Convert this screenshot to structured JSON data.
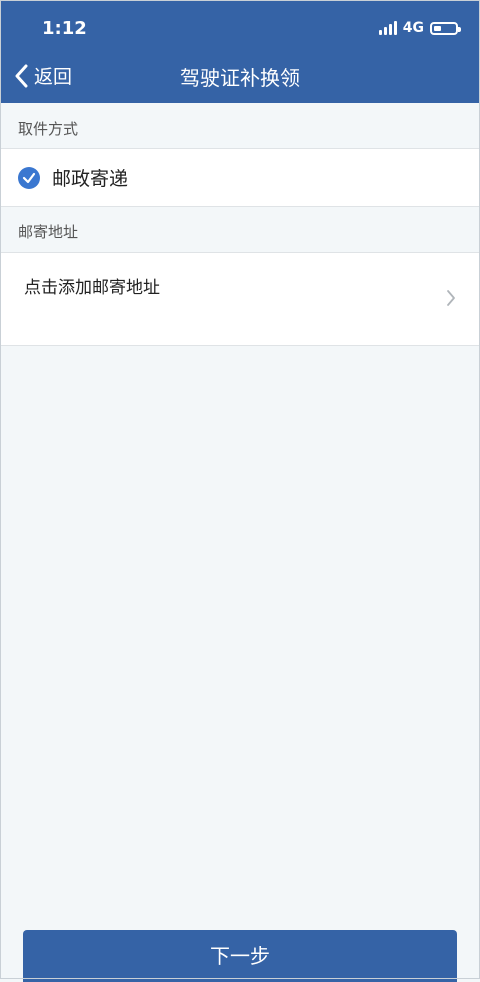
{
  "status_bar": {
    "time": "1:12",
    "network": "4G",
    "battery_level": 0.35
  },
  "header": {
    "back_label": "返回",
    "title": "驾驶证补换领"
  },
  "pickup": {
    "section_label": "取件方式",
    "selected_option": "邮政寄递"
  },
  "address": {
    "section_label": "邮寄地址",
    "add_prompt": "点击添加邮寄地址"
  },
  "footer": {
    "next_label": "下一步"
  },
  "colors": {
    "primary": "#3563a6",
    "check": "#3a77d0",
    "background": "#f3f7f9"
  }
}
